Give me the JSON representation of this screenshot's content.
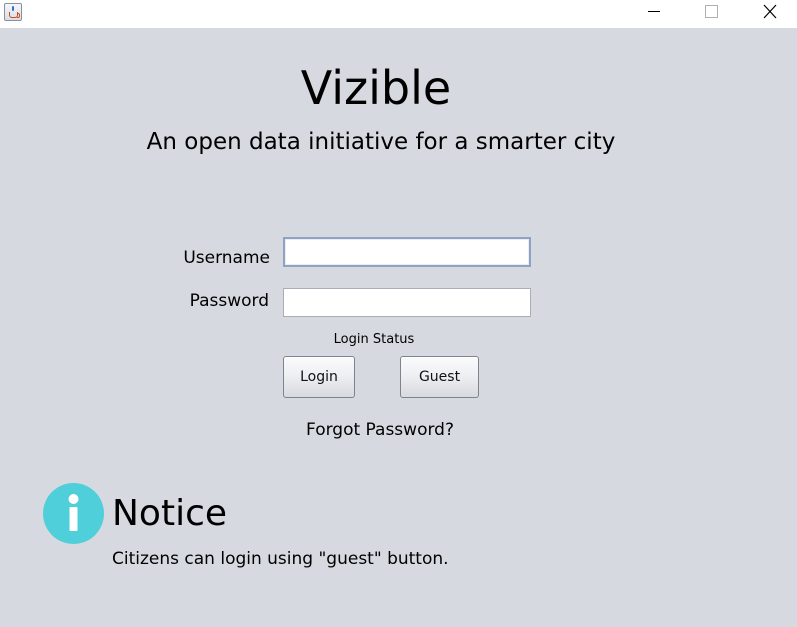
{
  "window": {
    "controls": [
      "minimize-icon",
      "maximize-icon",
      "close-icon"
    ],
    "app_icon": "java-cup-icon"
  },
  "header": {
    "title": "Vizible",
    "subtitle": "An open data initiative for a smarter city"
  },
  "login_form": {
    "username_label": "Username",
    "username_value": "",
    "password_label": "Password",
    "password_value": "",
    "status_text": "Login Status",
    "login_button": "Login",
    "guest_button": "Guest",
    "forgot_password": "Forgot Password?"
  },
  "notice": {
    "icon": "info-icon",
    "icon_color": "#4ecfd9",
    "title": "Notice",
    "text": "Citizens can login using \"guest\" button."
  },
  "colors": {
    "background": "#d6d9e0",
    "focus_border": "#8ea3c2"
  }
}
